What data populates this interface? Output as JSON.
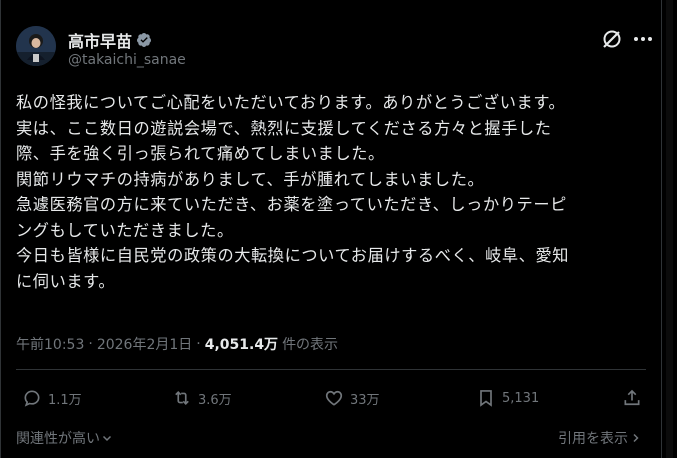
{
  "author": {
    "name": "高市早苗",
    "handle": "@takaichi_sanae",
    "avatar_icon": "profile-photo-avatar",
    "verified_icon": "verified-badge-icon",
    "verified_color": "#8b98a5"
  },
  "header_actions": {
    "grok_icon": "grok-icon",
    "more_icon": "more-dots-icon"
  },
  "post": {
    "lines": [
      "私の怪我についてご心配をいただいております。ありがとうございます。",
      "実は、ここ数日の遊説会場で、熱烈に支援してくださる方々と握手した",
      "際、手を強く引っ張られて痛めてしまいました。",
      "関節リウマチの持病がありまして、手が腫れてしまいました。",
      "急遽医務官の方に来ていただき、お薬を塗っていただき、しっかりテーピ",
      "ングもしていただきました。",
      "今日も皆様に自民党の政策の大転換についてお届けするべく、岐阜、愛知",
      "に伺います。"
    ],
    "time": "午前10:53",
    "date": "2026年2月1日",
    "views_count": "4,051.4万",
    "views_label": "件の表示"
  },
  "actions": {
    "reply_count": "1.1万",
    "repost_count": "3.6万",
    "like_count": "33万",
    "bookmark_count": "5,131"
  },
  "footer": {
    "sort_label": "関連性が高い",
    "quote_label": "引用を表示"
  },
  "colors": {
    "background": "#000000",
    "text_primary": "#e7e9ea",
    "text_secondary": "#71767b",
    "divider": "#2f3336"
  }
}
